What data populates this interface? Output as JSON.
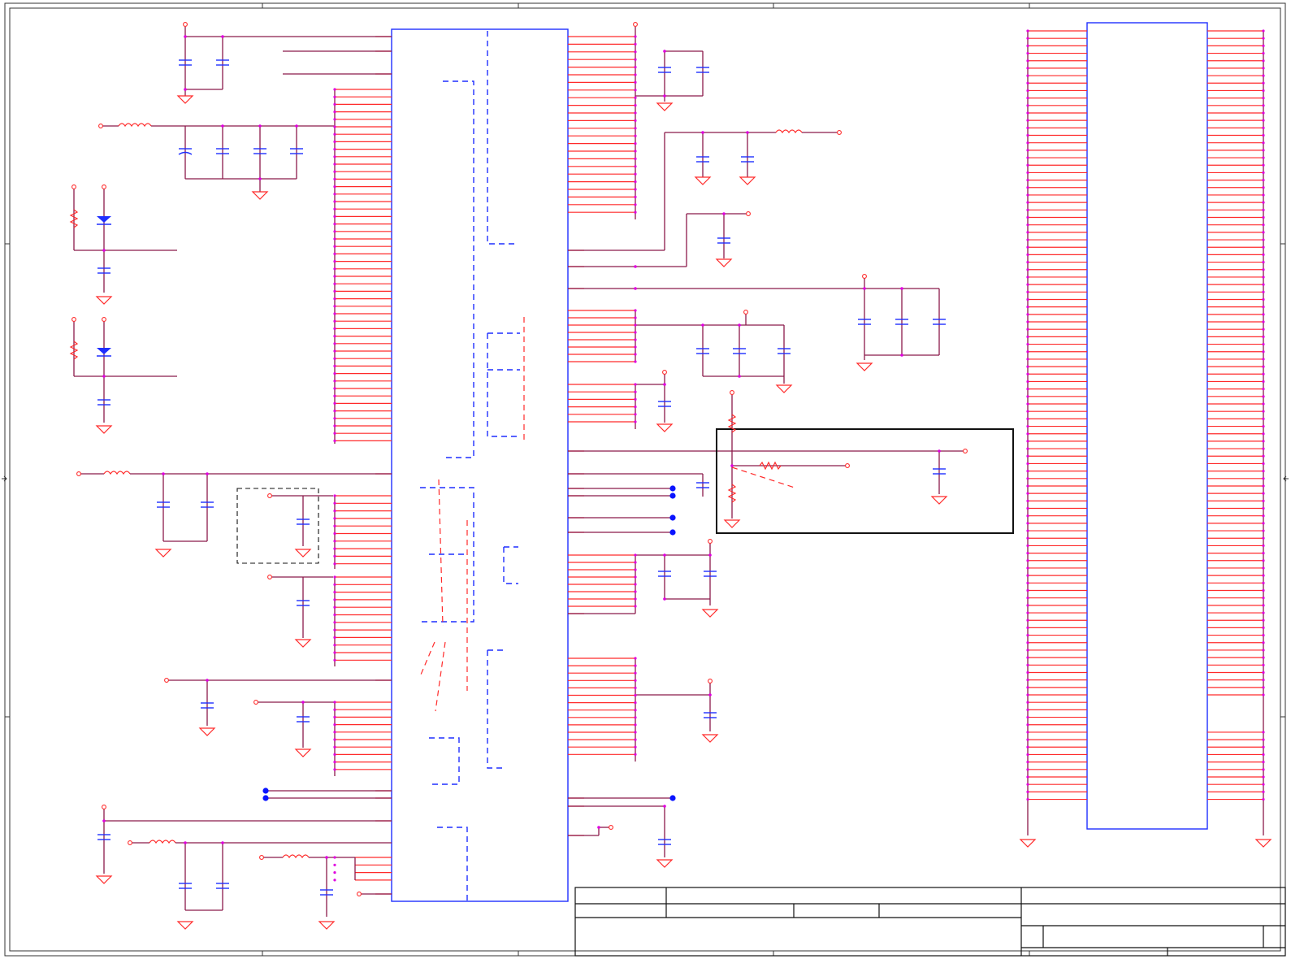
{
  "schematic": {
    "wire_color": "#8b1a4a",
    "pin_color": "#ff2a2a",
    "body_color": "#1f2fff",
    "junction_color": "#e000e0",
    "dot_color": "#0a14ff"
  }
}
